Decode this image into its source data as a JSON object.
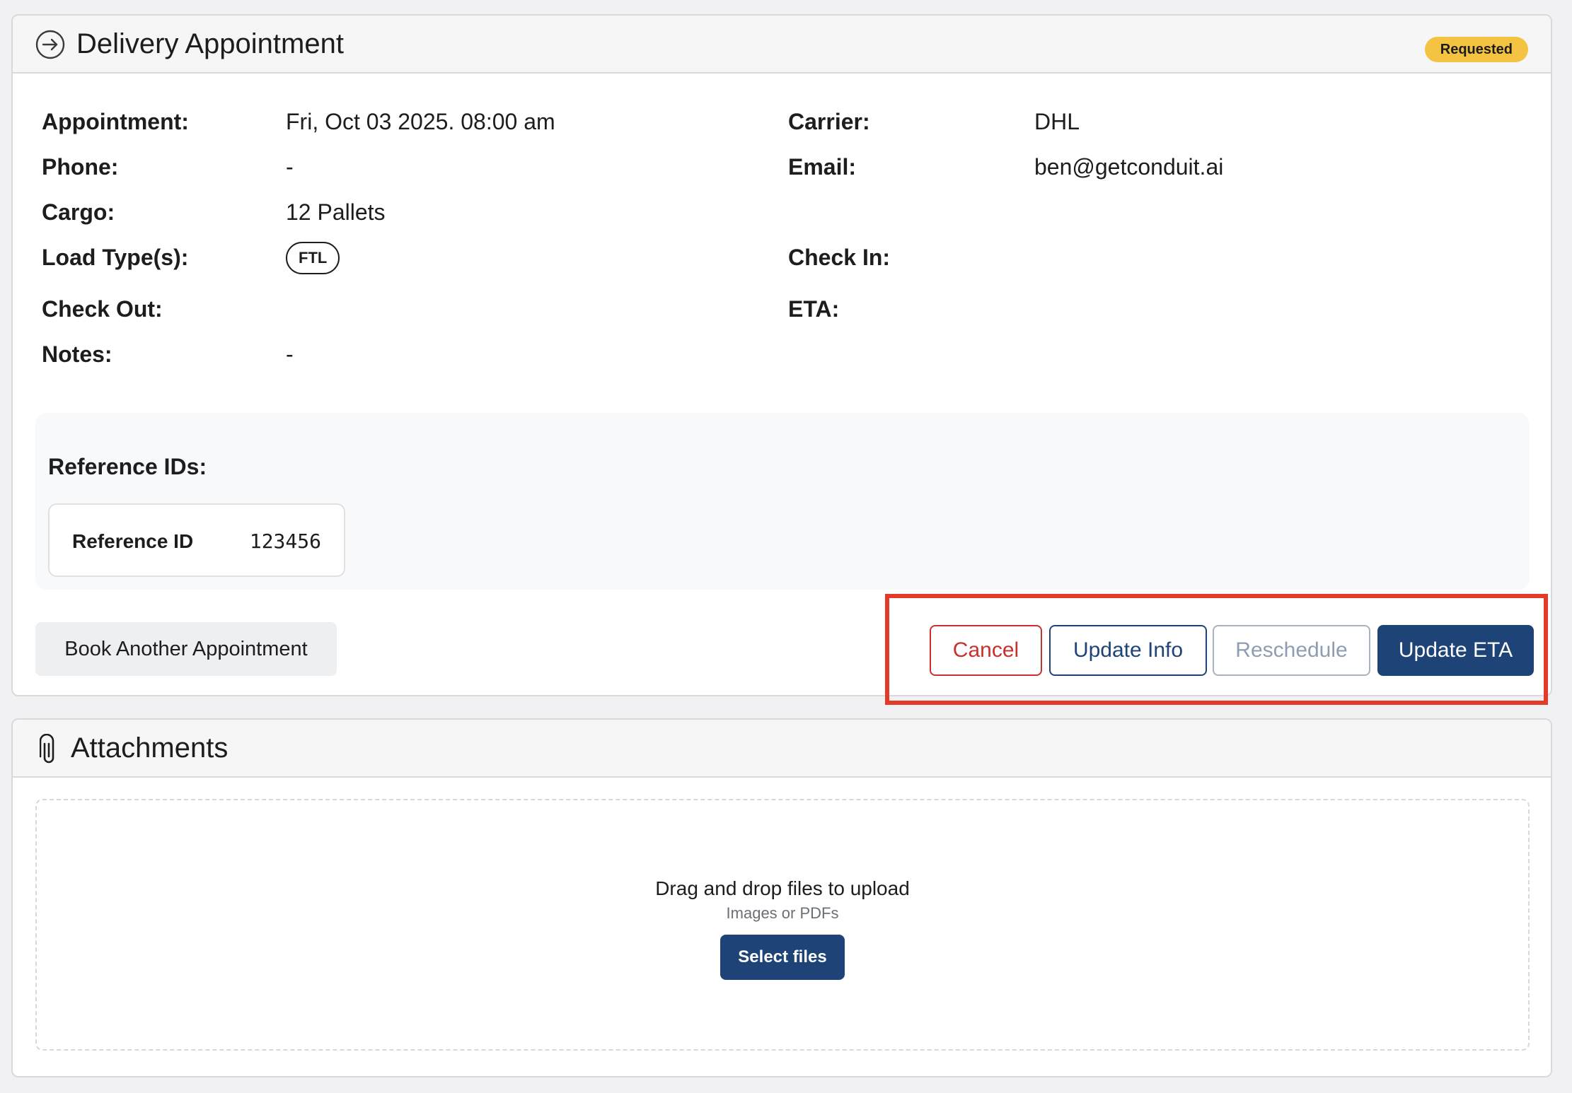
{
  "appointment": {
    "title": "Delivery Appointment",
    "status": "Requested",
    "fields": {
      "appointment_label": "Appointment:",
      "appointment_value": "Fri, Oct 03 2025. 08:00 am",
      "carrier_label": "Carrier:",
      "carrier_value": "DHL",
      "phone_label": "Phone:",
      "phone_value": "-",
      "email_label": "Email:",
      "email_value": "ben@getconduit.ai",
      "cargo_label": "Cargo:",
      "cargo_value": "12 Pallets",
      "load_type_label": "Load Type(s):",
      "load_type_value": "FTL",
      "check_in_label": "Check In:",
      "check_out_label": "Check Out:",
      "eta_label": "ETA:",
      "notes_label": "Notes:",
      "notes_value": "-"
    },
    "reference_ids": {
      "title": "Reference IDs:",
      "items": [
        {
          "label": "Reference ID",
          "value": "123456"
        }
      ]
    },
    "actions": {
      "book_another": "Book Another Appointment",
      "cancel": "Cancel",
      "update_info": "Update Info",
      "reschedule": "Reschedule",
      "update_eta": "Update ETA"
    }
  },
  "attachments": {
    "title": "Attachments",
    "drop_title": "Drag and drop files to upload",
    "drop_subtitle": "Images or PDFs",
    "select_files": "Select files"
  },
  "colors": {
    "primary": "#1e4477",
    "danger": "#c8312d",
    "status_badge": "#f5c342",
    "highlight": "#e23b2a",
    "disabled": "#8e9db1"
  },
  "icons": {
    "header_icon": "arrow-right-circle-icon",
    "attachments_icon": "paperclip-icon"
  }
}
